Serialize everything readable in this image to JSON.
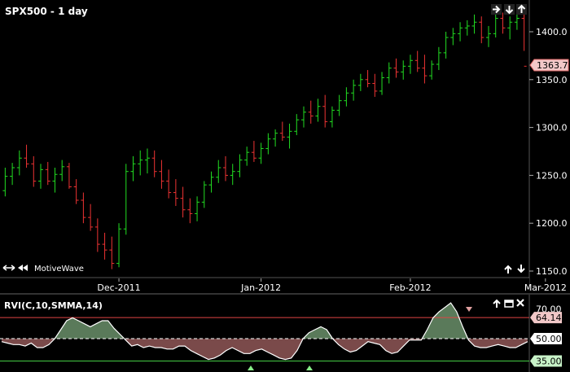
{
  "main_panel": {
    "title": "SPX500 - 1 day",
    "watermark": "MotiveWave",
    "last_price": "1363.7",
    "price_ticks": [
      "1400.0",
      "1350.0",
      "1300.0",
      "1250.0",
      "1200.0",
      "1150.0"
    ],
    "date_ticks": [
      "Dec-2011",
      "Jan-2012",
      "Feb-2012",
      "Mar-2012"
    ],
    "up_color": "#22dd22",
    "down_color": "#ee3333",
    "icons": [
      "arrow-right-icon",
      "arrow-down-icon",
      "arrow-up-icon",
      "arrows-left-right-icon",
      "arrow-up-icon",
      "arrow-down-icon"
    ]
  },
  "rvi_panel": {
    "title": "RVI(C,10,SMMA,14)",
    "value_ticks": [
      "70.00",
      "50.00",
      "35.00"
    ],
    "current_value": "64.14",
    "upper_level": "64.14",
    "lower_level": "35.00",
    "mid_level": "50.00",
    "fill_above_color": "#5a7a5a",
    "fill_below_color": "#7a4a4a",
    "icons": [
      "arrow-up-icon",
      "restore-icon",
      "close-icon"
    ]
  },
  "chart_data": [
    {
      "type": "ohlc",
      "title": "SPX500 - 1 day",
      "ylim": [
        1150,
        1420
      ],
      "bars": [
        [
          1234,
          1258,
          1228,
          1249
        ],
        [
          1249,
          1263,
          1240,
          1258
        ],
        [
          1258,
          1276,
          1250,
          1268
        ],
        [
          1268,
          1282,
          1258,
          1262
        ],
        [
          1262,
          1270,
          1238,
          1244
        ],
        [
          1244,
          1262,
          1236,
          1256
        ],
        [
          1256,
          1264,
          1240,
          1244
        ],
        [
          1244,
          1258,
          1232,
          1251
        ],
        [
          1251,
          1266,
          1244,
          1259
        ],
        [
          1259,
          1263,
          1236,
          1238
        ],
        [
          1238,
          1246,
          1220,
          1224
        ],
        [
          1224,
          1232,
          1200,
          1206
        ],
        [
          1206,
          1220,
          1192,
          1196
        ],
        [
          1196,
          1205,
          1170,
          1178
        ],
        [
          1178,
          1190,
          1162,
          1172
        ],
        [
          1172,
          1186,
          1152,
          1158
        ],
        [
          1158,
          1200,
          1154,
          1194
        ],
        [
          1194,
          1262,
          1188,
          1254
        ],
        [
          1254,
          1270,
          1244,
          1262
        ],
        [
          1262,
          1276,
          1250,
          1266
        ],
        [
          1266,
          1278,
          1252,
          1268
        ],
        [
          1268,
          1276,
          1248,
          1254
        ],
        [
          1254,
          1266,
          1236,
          1244
        ],
        [
          1244,
          1256,
          1226,
          1232
        ],
        [
          1232,
          1246,
          1218,
          1226
        ],
        [
          1226,
          1238,
          1206,
          1214
        ],
        [
          1214,
          1226,
          1200,
          1210
        ],
        [
          1210,
          1228,
          1202,
          1222
        ],
        [
          1222,
          1244,
          1216,
          1240
        ],
        [
          1240,
          1254,
          1232,
          1248
        ],
        [
          1248,
          1266,
          1242,
          1258
        ],
        [
          1258,
          1270,
          1244,
          1250
        ],
        [
          1250,
          1262,
          1240,
          1254
        ],
        [
          1254,
          1272,
          1248,
          1266
        ],
        [
          1266,
          1280,
          1260,
          1274
        ],
        [
          1274,
          1286,
          1264,
          1268
        ],
        [
          1268,
          1284,
          1262,
          1278
        ],
        [
          1278,
          1294,
          1272,
          1288
        ],
        [
          1288,
          1298,
          1280,
          1294
        ],
        [
          1294,
          1306,
          1286,
          1290
        ],
        [
          1290,
          1304,
          1278,
          1296
        ],
        [
          1296,
          1314,
          1292,
          1308
        ],
        [
          1308,
          1322,
          1300,
          1316
        ],
        [
          1316,
          1328,
          1304,
          1312
        ],
        [
          1312,
          1330,
          1306,
          1322
        ],
        [
          1322,
          1334,
          1300,
          1306
        ],
        [
          1306,
          1322,
          1300,
          1318
        ],
        [
          1318,
          1334,
          1312,
          1328
        ],
        [
          1328,
          1342,
          1322,
          1336
        ],
        [
          1336,
          1350,
          1328,
          1344
        ],
        [
          1344,
          1356,
          1338,
          1350
        ],
        [
          1350,
          1360,
          1342,
          1346
        ],
        [
          1346,
          1356,
          1332,
          1338
        ],
        [
          1338,
          1358,
          1334,
          1352
        ],
        [
          1352,
          1368,
          1346,
          1362
        ],
        [
          1362,
          1372,
          1352,
          1358
        ],
        [
          1358,
          1370,
          1350,
          1364
        ],
        [
          1364,
          1376,
          1356,
          1370
        ],
        [
          1370,
          1380,
          1358,
          1362
        ],
        [
          1362,
          1376,
          1346,
          1354
        ],
        [
          1354,
          1370,
          1350,
          1366
        ],
        [
          1366,
          1384,
          1360,
          1378
        ],
        [
          1378,
          1400,
          1372,
          1394
        ],
        [
          1394,
          1404,
          1386,
          1398
        ],
        [
          1398,
          1410,
          1390,
          1404
        ],
        [
          1404,
          1412,
          1396,
          1406
        ],
        [
          1406,
          1418,
          1398,
          1410
        ],
        [
          1410,
          1416,
          1388,
          1394
        ],
        [
          1394,
          1406,
          1384,
          1398
        ],
        [
          1398,
          1422,
          1394,
          1414
        ],
        [
          1414,
          1420,
          1398,
          1404
        ],
        [
          1404,
          1416,
          1392,
          1410
        ],
        [
          1410,
          1422,
          1402,
          1414
        ],
        [
          1414,
          1420,
          1380,
          1364
        ]
      ]
    },
    {
      "type": "area",
      "title": "RVI(C,10,SMMA,14)",
      "ylim": [
        30,
        75
      ],
      "levels": [
        64.14,
        50.0,
        35.0
      ],
      "values": [
        48,
        47,
        46,
        46,
        45,
        47,
        44,
        44,
        46,
        50,
        56,
        62,
        64,
        62,
        60,
        58,
        60,
        62,
        62,
        57,
        53,
        49,
        45,
        46,
        44,
        45,
        44,
        44,
        43,
        43,
        45,
        45,
        42,
        40,
        38,
        36,
        37,
        39,
        42,
        44,
        42,
        40,
        40,
        42,
        43,
        41,
        39,
        37,
        36,
        37,
        42,
        50,
        54,
        56,
        58,
        56,
        50,
        46,
        43,
        41,
        42,
        45,
        48,
        47,
        46,
        42,
        40,
        41,
        45,
        49,
        49,
        49,
        56,
        64,
        68,
        71,
        74,
        68,
        58,
        49,
        45,
        44,
        44,
        45,
        46,
        45,
        44,
        44,
        46,
        48
      ]
    }
  ]
}
